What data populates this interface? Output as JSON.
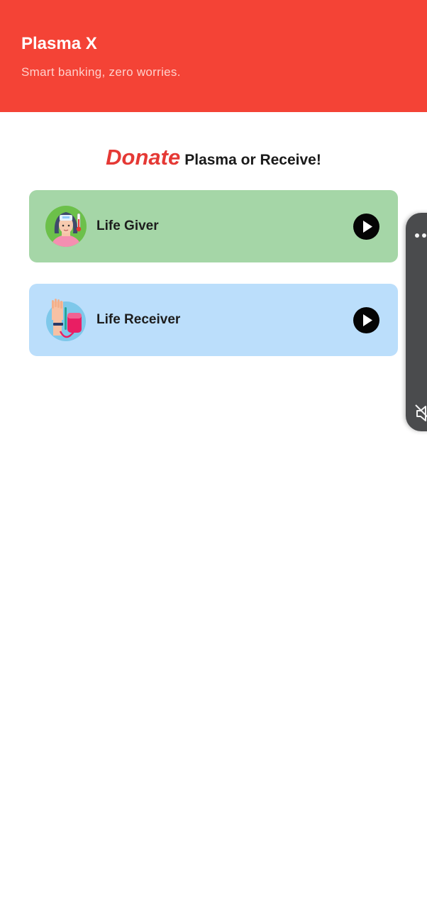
{
  "header": {
    "title": "Plasma X",
    "subtitle": "Smart banking, zero worries.",
    "background_color": "#f44336"
  },
  "headline": {
    "accent": "Donate",
    "rest": "Plasma or Receive!",
    "accent_color": "#e53935"
  },
  "options": [
    {
      "label": "Life Giver",
      "icon": "thermometer-person-icon",
      "action_icon": "play-icon",
      "background_color": "#a5d6a7"
    },
    {
      "label": "Life Receiver",
      "icon": "blood-bag-hand-icon",
      "action_icon": "play-icon",
      "background_color": "#bbdefb"
    }
  ],
  "overlay_panel": {
    "icons": [
      "more-dots-icon",
      "volume-mute-icon"
    ]
  }
}
